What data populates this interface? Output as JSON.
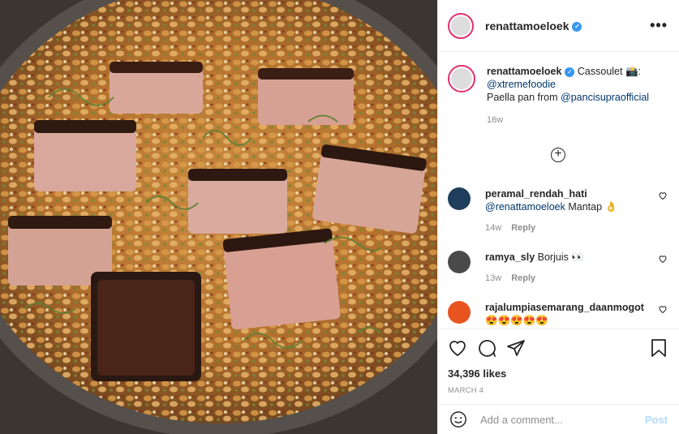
{
  "post": {
    "username": "renattamoeloek",
    "verified_mark": "✓",
    "more_glyph": "•••",
    "photo_alt": "Cassoulet"
  },
  "caption": {
    "username": "renattamoeloek",
    "text1": "Cassoulet 📸:",
    "mention1": "@xtremefoodie",
    "text2": "Paella pan from ",
    "mention2": "@pancisupraofficial",
    "time": "16w"
  },
  "load_more_glyph": "+",
  "comments": [
    {
      "username": "peramal_rendah_hati",
      "mention": "@renattamoeloek",
      "text": " Mantap 👌",
      "time": "14w",
      "reply": "Reply",
      "avatar_color": "#1f3d5c"
    },
    {
      "username": "ramya_sly",
      "mention": "",
      "text": " Borjuis 👀",
      "time": "13w",
      "reply": "Reply",
      "avatar_color": "#4a4a4a"
    },
    {
      "username": "rajalumpiasemarang_daanmogot",
      "mention": "",
      "text": "😍😍😍😍😍",
      "time": "",
      "reply": "",
      "avatar_color": "#e8541e"
    }
  ],
  "likes": "34,396 likes",
  "date": "MARCH 4",
  "add_comment": {
    "placeholder": "Add a comment...",
    "post_label": "Post"
  },
  "colors": {
    "accent": "#0095f6",
    "link": "#00376b",
    "muted": "#8e8e8e",
    "story_ring": "#e1306c"
  },
  "icons": [
    "heart-icon",
    "comment-icon",
    "share-icon",
    "bookmark-icon",
    "emoji-icon",
    "plus-circle-icon",
    "more-icon"
  ]
}
